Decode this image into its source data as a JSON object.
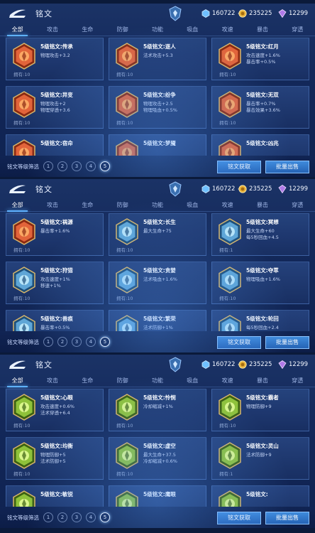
{
  "header": {
    "title": "铭文"
  },
  "currency": {
    "gold": "160722",
    "coupons": "235225",
    "gems": "12299",
    "plus": "+"
  },
  "tabs": [
    "全部",
    "攻击",
    "生命",
    "防御",
    "功能",
    "吸血",
    "攻速",
    "暴击",
    "穿透"
  ],
  "footer": {
    "filter_label": "铭文等级筛选",
    "levels": [
      "1",
      "2",
      "3",
      "4",
      "5"
    ],
    "obtain_button": "铭文获取",
    "sell_button": "批量出售"
  },
  "colors": {
    "accent_blue": "#5fb2ff",
    "red_gem": "#e2643a",
    "blue_gem": "#5fa6d6",
    "green_gem": "#8fc23a"
  },
  "screens": [
    {
      "cards": [
        {
          "name": "5级铭文:传承",
          "attrs": [
            "物理攻击+3.2",
            ""
          ],
          "owned": "拥有:10",
          "icon": "red-rune-icon"
        },
        {
          "name": "5级铭文:逐人",
          "attrs": [
            "法术攻击+5.3",
            ""
          ],
          "owned": "拥有:10",
          "icon": "red-rune-icon"
        },
        {
          "name": "5级铭文:红月",
          "attrs": [
            "攻击速度+1.6%",
            "暴击率+0.5%"
          ],
          "owned": "拥有:10",
          "icon": "red-rune-icon"
        },
        {
          "name": "5级铭文:异变",
          "attrs": [
            "物理攻击+2",
            "物理穿透+3.6"
          ],
          "owned": "拥有:10",
          "icon": "red-rune-icon"
        },
        {
          "name": "5级铭文:纷争",
          "attrs": [
            "物理攻击+2.5",
            "物理吸血+0.5%"
          ],
          "owned": "拥有:10",
          "icon": "red-rune-icon"
        },
        {
          "name": "5级铭文:无双",
          "attrs": [
            "暴击率+0.7%",
            "暴击效果+3.6%"
          ],
          "owned": "拥有:10",
          "icon": "red-rune-icon"
        },
        {
          "name": "5级铭文:宿命",
          "attrs": [
            "",
            ""
          ],
          "owned": "",
          "icon": "red-rune-icon"
        },
        {
          "name": "5级铭文:梦魇",
          "attrs": [
            "",
            ""
          ],
          "owned": "",
          "icon": "red-rune-icon"
        },
        {
          "name": "5级铭文:凶兆",
          "attrs": [
            "",
            ""
          ],
          "owned": "",
          "icon": "red-rune-icon"
        }
      ]
    },
    {
      "cards": [
        {
          "name": "5级铭文:祸源",
          "attrs": [
            "暴击率+1.6%",
            ""
          ],
          "owned": "拥有:10",
          "icon": "red-rune-icon"
        },
        {
          "name": "5级铭文:长生",
          "attrs": [
            "最大生命+75",
            ""
          ],
          "owned": "拥有:10",
          "icon": "blue-rune-icon"
        },
        {
          "name": "5级铭文:冥想",
          "attrs": [
            "最大生命+60",
            "每5秒回血+4.5"
          ],
          "owned": "拥有:1",
          "icon": "blue-rune-icon"
        },
        {
          "name": "5级铭文:狩猎",
          "attrs": [
            "攻击速度+1%",
            "移速+1%"
          ],
          "owned": "拥有:10",
          "icon": "blue-rune-icon"
        },
        {
          "name": "5级铭文:贪婪",
          "attrs": [
            "法术吸血+1.6%",
            ""
          ],
          "owned": "拥有:10",
          "icon": "blue-rune-icon"
        },
        {
          "name": "5级铭文:夺萃",
          "attrs": [
            "物理吸血+1.6%",
            ""
          ],
          "owned": "拥有:10",
          "icon": "blue-rune-icon"
        },
        {
          "name": "5级铭文:兽痕",
          "attrs": [
            "暴击率+0.5%",
            ""
          ],
          "owned": "",
          "icon": "blue-rune-icon"
        },
        {
          "name": "5级铭文:繁荣",
          "attrs": [
            "法术防御+1%",
            ""
          ],
          "owned": "",
          "icon": "blue-rune-icon"
        },
        {
          "name": "5级铭文:轮回",
          "attrs": [
            "每5秒回血+2.4",
            ""
          ],
          "owned": "",
          "icon": "blue-rune-icon"
        }
      ]
    },
    {
      "cards": [
        {
          "name": "5级铭文:心眼",
          "attrs": [
            "攻击速度+0.6%",
            "法术穿透+6.4"
          ],
          "owned": "拥有:10",
          "icon": "green-rune-icon"
        },
        {
          "name": "5级铭文:怜悯",
          "attrs": [
            "冷却缩减+1%",
            ""
          ],
          "owned": "拥有:10",
          "icon": "green-rune-icon"
        },
        {
          "name": "5级铭文:霸者",
          "attrs": [
            "物理防御+9",
            ""
          ],
          "owned": "拥有:10",
          "icon": "green-rune-icon"
        },
        {
          "name": "5级铭文:均衡",
          "attrs": [
            "物理防御+5",
            "法术防御+5"
          ],
          "owned": "拥有:10",
          "icon": "green-rune-icon"
        },
        {
          "name": "5级铭文:虚空",
          "attrs": [
            "最大生命+37.5",
            "冷却缩减+0.6%"
          ],
          "owned": "拥有:10",
          "icon": "green-rune-icon"
        },
        {
          "name": "5级铭文:灵山",
          "attrs": [
            "法术防御+9",
            ""
          ],
          "owned": "拥有:1",
          "icon": "green-rune-icon"
        },
        {
          "name": "5级铭文:敏锐",
          "attrs": [
            "",
            ""
          ],
          "owned": "",
          "icon": "green-rune-icon"
        },
        {
          "name": "5级铭文:鹰眼",
          "attrs": [
            "",
            ""
          ],
          "owned": "",
          "icon": "green-rune-icon"
        },
        {
          "name": "5级铭文:",
          "attrs": [
            "",
            ""
          ],
          "owned": "",
          "icon": "green-rune-icon"
        }
      ]
    }
  ]
}
